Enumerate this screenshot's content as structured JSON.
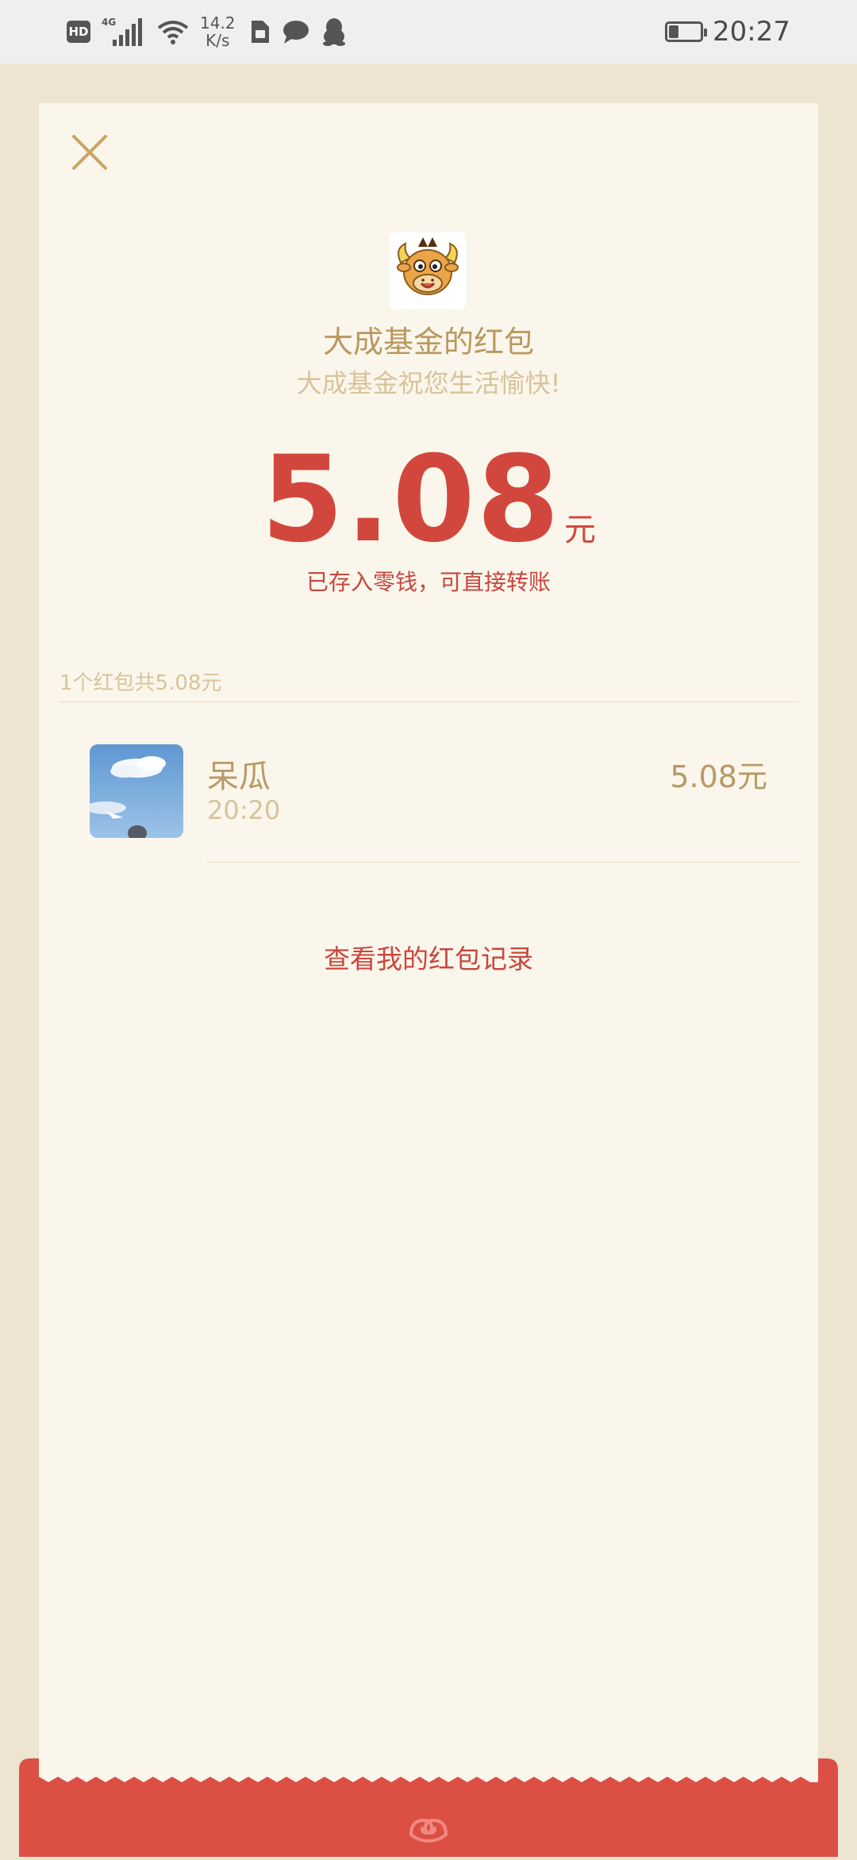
{
  "status_bar": {
    "hd_label": "HD",
    "network_label": "4G",
    "speed_value": "14.2",
    "speed_unit": "K/s",
    "time": "20:27",
    "icons": [
      "signal-icon",
      "wifi-icon",
      "sim-icon",
      "chat-bubble-icon",
      "qq-penguin-icon",
      "battery-icon"
    ]
  },
  "packet": {
    "sender_title": "大成基金的红包",
    "wish": "大成基金祝您生活愉快!",
    "amount": "5.08",
    "amount_unit": "元",
    "stored_note": "已存入零钱，可直接转账"
  },
  "summary": "1个红包共5.08元",
  "recipients": [
    {
      "name": "呆瓜",
      "time": "20:20",
      "amount": "5.08元"
    }
  ],
  "record_link": "查看我的红包记录",
  "colors": {
    "accent_red": "#d2473d",
    "gold_text": "#b69a66",
    "card_bg": "#fbf6eb",
    "outer_bg": "#ede4d1"
  }
}
